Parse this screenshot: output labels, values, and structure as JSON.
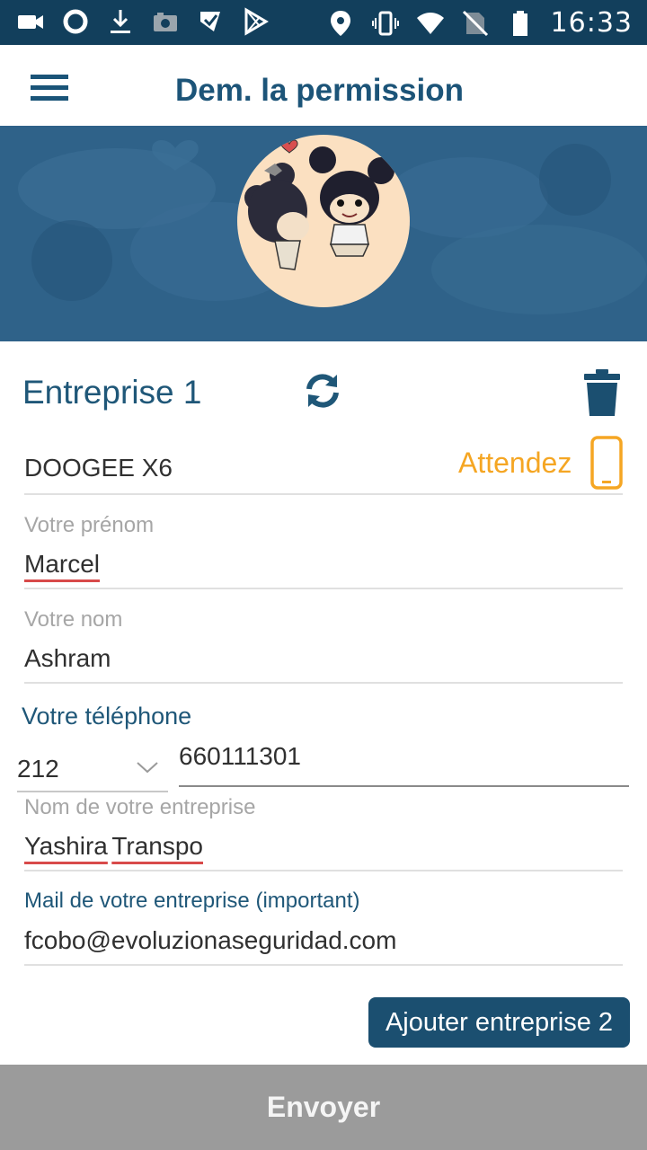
{
  "status_bar": {
    "time": "16:33",
    "left_icons": [
      "video-icon",
      "sync-circle-icon",
      "download-icon",
      "camera-icon",
      "task-icon",
      "play-store-icon"
    ],
    "right_icons": [
      "location-icon",
      "vibrate-icon",
      "wifi-icon",
      "no-sim-icon",
      "battery-icon"
    ]
  },
  "app_bar": {
    "title": "Dem. la permission",
    "menu_icon": "hamburger-menu-icon"
  },
  "colors": {
    "primary": "#1b4f70",
    "status_bar": "#123f5c",
    "banner": "#2f6289",
    "warning": "#f5a623",
    "disabled_button": "#9b9b9b"
  },
  "company": {
    "title": "Entreprise 1",
    "refresh_icon": "refresh-icon",
    "delete_icon": "trash-icon"
  },
  "device": {
    "name": "DOOGEE X6",
    "status": "Attendez",
    "status_icon": "smartphone-icon"
  },
  "form": {
    "first_name": {
      "label": "Votre prénom",
      "value": "Marcel"
    },
    "last_name": {
      "label": "Votre nom",
      "value": "Ashram"
    },
    "phone": {
      "label": "Votre téléphone",
      "prefix": "212",
      "number": "660111301"
    },
    "company_name": {
      "label": "Nom de votre entreprise",
      "value_part1": "Yashira",
      "value_part2": "Transpo"
    },
    "company_email": {
      "label": "Mail de votre entreprise (important)",
      "value": "fcobo@evoluzionaseguridad.com"
    }
  },
  "buttons": {
    "add_company": "Ajouter entreprise 2",
    "send": "Envoyer"
  }
}
